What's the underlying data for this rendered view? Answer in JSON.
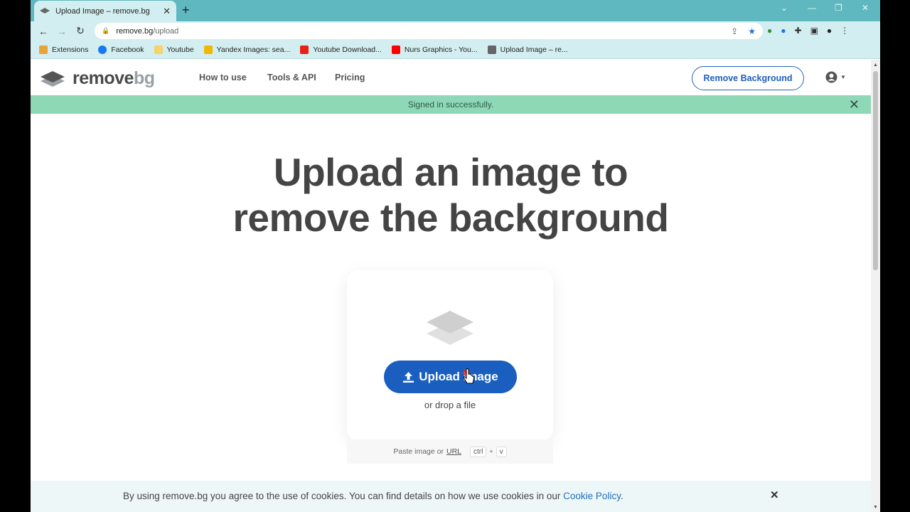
{
  "browser": {
    "tab_title": "Upload Image – remove.bg",
    "tab_close": "✕",
    "new_tab": "+",
    "url_host": "remove.bg",
    "url_path": "/upload",
    "bookmarks": [
      {
        "label": "Extensions",
        "color": "#e8a33a"
      },
      {
        "label": "Facebook",
        "color": "#1877f2"
      },
      {
        "label": "Youtube",
        "color": "#f5d26a"
      },
      {
        "label": "Yandex Images: sea...",
        "color": "#f2b705"
      },
      {
        "label": "Youtube Download...",
        "color": "#e62117"
      },
      {
        "label": "Nurs Graphics - You...",
        "color": "#ff0000"
      },
      {
        "label": "Upload Image – re...",
        "color": "#666666"
      }
    ]
  },
  "site": {
    "logo_main": "remove",
    "logo_accent": "bg",
    "nav": [
      "How to use",
      "Tools & API",
      "Pricing"
    ],
    "cta": "Remove Background",
    "success_message": "Signed in successfully.",
    "headline_line1": "Upload an image to",
    "headline_line2": "remove the background",
    "upload_button": "Upload Image",
    "drop_text": "or drop a file",
    "paste_text": "Paste image or",
    "paste_url": "URL",
    "key_ctrl": "ctrl",
    "key_plus": "+",
    "key_v": "v",
    "cookie_text": "By using remove.bg you agree to the use of cookies. You can find details on how we use cookies in our",
    "cookie_link": "Cookie Policy",
    "cookie_period": ".",
    "cookie_close": "✕"
  },
  "colors": {
    "accent": "#1a5fbf",
    "success": "#8fd8b6",
    "tabstrip": "#5fb8c0"
  }
}
